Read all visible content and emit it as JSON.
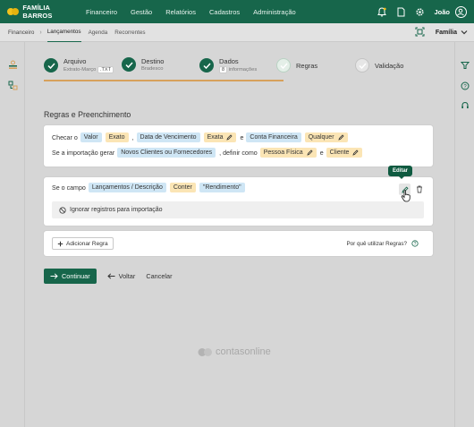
{
  "brand": {
    "name": "FAMÍLIA BARROS"
  },
  "nav": [
    "Financeiro",
    "Gestão",
    "Relatórios",
    "Cadastros",
    "Administração"
  ],
  "user": {
    "name": "João"
  },
  "breadcrumb": {
    "root": "Financeiro"
  },
  "subtabs": [
    {
      "label": "Lançamentos",
      "active": true
    },
    {
      "label": "Agenda",
      "active": false
    },
    {
      "label": "Recorrentes",
      "active": false
    }
  ],
  "family_selector": {
    "label": "Família"
  },
  "steps": [
    {
      "label": "Arquivo",
      "sub": "Extrato-Março",
      "badge": ".TXT",
      "status": "done"
    },
    {
      "label": "Destino",
      "sub": "Bradesco",
      "status": "done"
    },
    {
      "label": "Dados",
      "badge": "8",
      "sub": "informações",
      "status": "done"
    },
    {
      "label": "Regras",
      "status": "active"
    },
    {
      "label": "Validação",
      "status": "todo"
    }
  ],
  "section_title": "Regras e Preenchimento",
  "check_row": {
    "t1": "Checar o",
    "c1": "Valor",
    "c2": "Exato",
    "sep1": ",",
    "c3": "Data de Vencimento",
    "c4": "Exata",
    "t2": "e",
    "c5": "Conta Financeira",
    "c6": "Qualquer"
  },
  "import_row": {
    "t1": "Se a importação gerar",
    "c1": "Novos Clientes ou Fornecedores",
    "t2": ", definir como",
    "c2": "Pessoa Física",
    "t3": "e",
    "c3": "Cliente"
  },
  "rule": {
    "t1": "Se o campo",
    "c1": "Lançamentos / Descrição",
    "c2": "Conter",
    "c3": "\"Rendimento\"",
    "ignore": "Ignorar registros para importação"
  },
  "tooltip": "Editar",
  "add_rule": "Adicionar Regra",
  "why": "Por quê utilizar Regras?",
  "actions": {
    "continue": "Continuar",
    "back": "Voltar",
    "cancel": "Cancelar"
  },
  "footer": "contasonline",
  "colors": {
    "primary": "#17664b",
    "chip_blue": "#cfe6f5",
    "chip_yellow": "#fbe5b5",
    "progress": "#d7a15c"
  }
}
